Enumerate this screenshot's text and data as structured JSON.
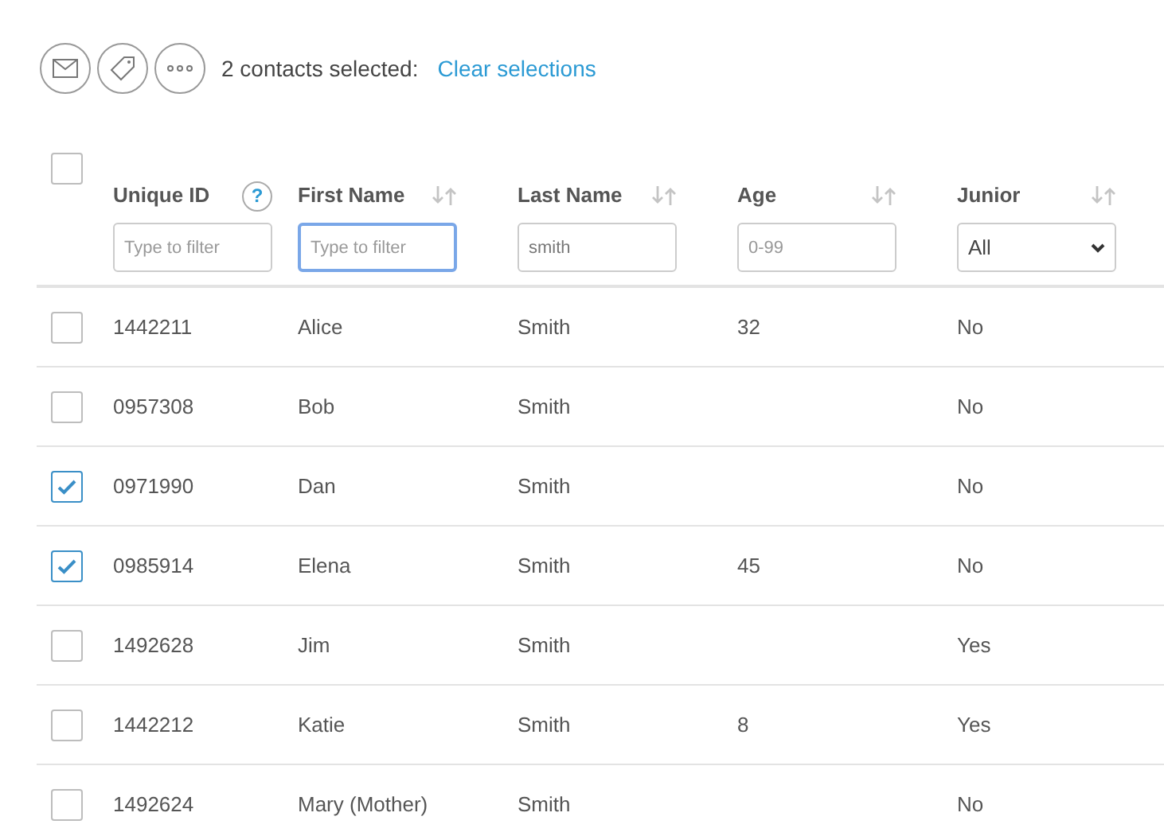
{
  "toolbar": {
    "selection_text": "2 contacts selected:",
    "clear_link": "Clear selections"
  },
  "header": {
    "select_all": {
      "checked": false
    },
    "columns": [
      {
        "kind": "help",
        "label": "Unique ID",
        "help": "?",
        "filter": {
          "placeholder": "Type to filter",
          "focused": false
        }
      },
      {
        "kind": "sort",
        "label": "First Name",
        "filter": {
          "placeholder": "Type to filter",
          "focused": true
        }
      },
      {
        "kind": "sort",
        "label": "Last Name",
        "filter": {
          "value": "smith",
          "focused": false
        }
      },
      {
        "kind": "sort",
        "label": "Age",
        "filter": {
          "placeholder": "0-99",
          "focused": false
        }
      },
      {
        "kind": "select",
        "label": "Junior",
        "filter": {
          "value": "All"
        }
      }
    ]
  },
  "rows": [
    {
      "checked": false,
      "cells": [
        "1442211",
        "Alice",
        "Smith",
        "32",
        "No"
      ]
    },
    {
      "checked": false,
      "cells": [
        "0957308",
        "Bob",
        "Smith",
        "",
        "No"
      ]
    },
    {
      "checked": true,
      "cells": [
        "0971990",
        "Dan",
        "Smith",
        "",
        "No"
      ]
    },
    {
      "checked": true,
      "cells": [
        "0985914",
        "Elena",
        "Smith",
        "45",
        "No"
      ]
    },
    {
      "checked": false,
      "cells": [
        "1492628",
        "Jim",
        "Smith",
        "",
        "Yes"
      ]
    },
    {
      "checked": false,
      "cells": [
        "1442212",
        "Katie",
        "Smith",
        "8",
        "Yes"
      ]
    },
    {
      "checked": false,
      "cells": [
        "1492624",
        "Mary (Mother)",
        "Smith",
        "",
        "No"
      ]
    }
  ]
}
